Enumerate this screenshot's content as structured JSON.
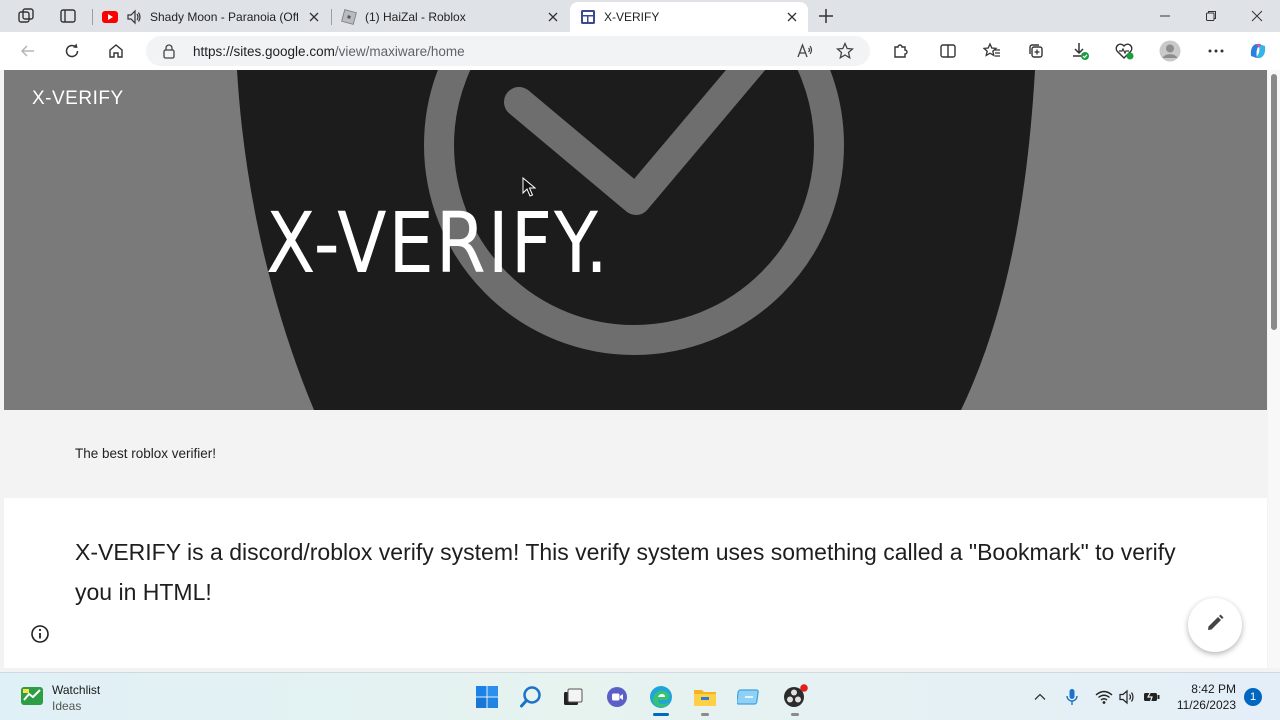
{
  "tabs": [
    {
      "title": "Shady Moon - Paranoia (Off",
      "icon": "youtube-icon"
    },
    {
      "title": "(1) HaiZal - Roblox",
      "icon": "roblox-icon"
    },
    {
      "title": "X-VERIFY",
      "icon": "google-sites-icon",
      "active": true
    }
  ],
  "address_bar": {
    "url_host": "https://sites.google.com",
    "url_path": "/view/maxiware/home"
  },
  "page": {
    "site_name": "X-VERIFY",
    "hero_title": "X-VERIFY.",
    "tagline": "The best roblox verifier!",
    "paragraph": "X-VERIFY is a discord/roblox verify system! This verify system uses something called a \"Bookmark\" to verify you in HTML!"
  },
  "taskbar": {
    "widget_title": "Watchlist",
    "widget_subtitle": "Ideas",
    "time": "8:42 PM",
    "date": "11/26/2023",
    "notification_count": "1"
  },
  "colors": {
    "hero_bg": "#7a7a7a",
    "hero_dark": "#1c1c1c",
    "accent": "#0067c0"
  }
}
